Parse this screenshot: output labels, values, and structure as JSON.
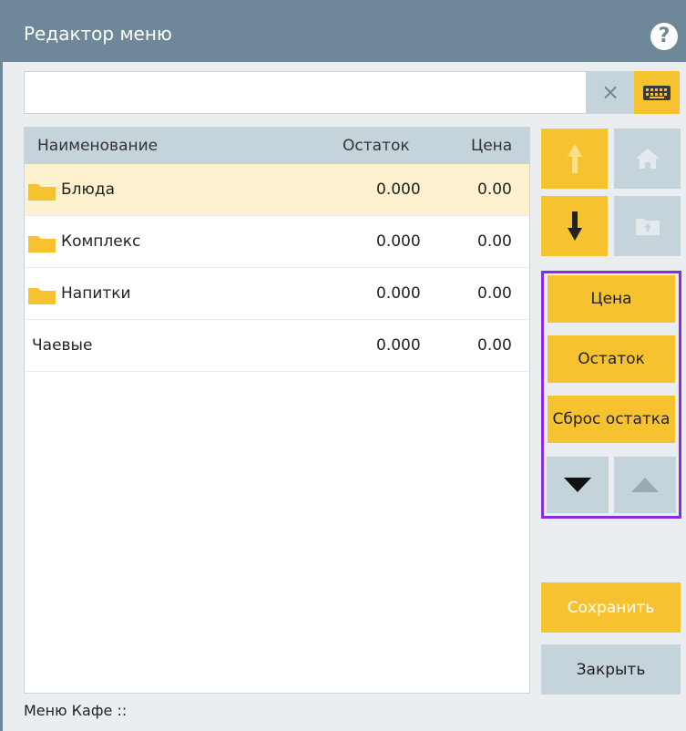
{
  "window": {
    "title": "Редактор меню",
    "help_label": "?"
  },
  "search": {
    "value": "",
    "placeholder": "",
    "clear_label": "×"
  },
  "table": {
    "columns": [
      "Наименование",
      "Остаток",
      "Цена"
    ],
    "rows": [
      {
        "name": "Блюда",
        "stock": "0.000",
        "price": "0.00",
        "is_folder": true,
        "selected": true
      },
      {
        "name": "Комплекс",
        "stock": "0.000",
        "price": "0.00",
        "is_folder": true,
        "selected": false
      },
      {
        "name": "Напитки",
        "stock": "0.000",
        "price": "0.00",
        "is_folder": true,
        "selected": false
      },
      {
        "name": "Чаевые",
        "stock": "0.000",
        "price": "0.00",
        "is_folder": false,
        "selected": false
      }
    ]
  },
  "side": {
    "price_label": "Цена",
    "stock_label": "Остаток",
    "reset_stock_label": "Сброс остатка"
  },
  "footer": {
    "save_label": "Сохранить",
    "close_label": "Закрыть",
    "status_text": "Меню Кафе ::"
  },
  "colors": {
    "accent": "#f6c230",
    "header_bg": "#6f8899",
    "grey_btn": "#c5d3da",
    "highlight": "#8a2be2",
    "selected_row": "#fdf1cf"
  },
  "icons": [
    "help-icon",
    "clear-icon",
    "keyboard-icon",
    "arrow-up-icon",
    "home-icon",
    "arrow-down-icon",
    "folder-up-icon",
    "triangle-down-icon",
    "triangle-up-icon",
    "folder-icon"
  ]
}
